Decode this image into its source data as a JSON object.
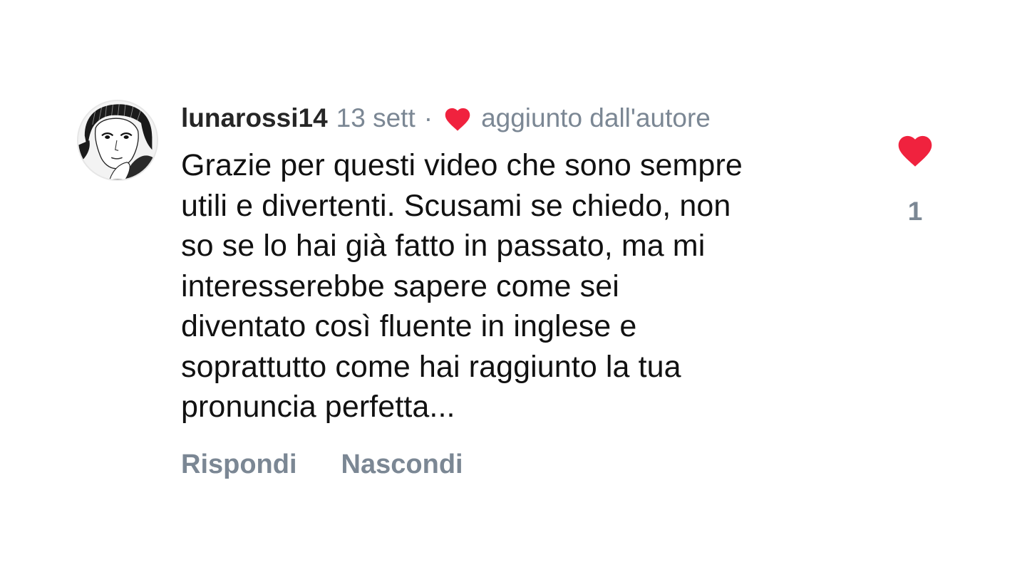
{
  "comment": {
    "username": "lunarossi14",
    "timestamp": "13 sett",
    "separator": "·",
    "author_liked_label": "aggiunto dall'autore",
    "avatar_icon": "user-avatar-icon",
    "text_lines": [
      "Grazie per questi video che sono sempre",
      "utili e divertenti. Scusami se chiedo, non",
      "so se lo hai già fatto in passato, ma mi",
      "interesserebbe sapere come sei",
      "diventato così fluente in inglese e",
      "soprattutto come hai raggiunto la tua",
      "pronuncia perfetta..."
    ],
    "actions": {
      "reply_label": "Rispondi",
      "hide_label": "Nascondi"
    },
    "likes": {
      "count": "1",
      "icon": "heart-icon",
      "liked": true
    }
  },
  "colors": {
    "heart": "#f0223e",
    "secondary_text": "#7b8794",
    "primary_text": "#111111"
  }
}
